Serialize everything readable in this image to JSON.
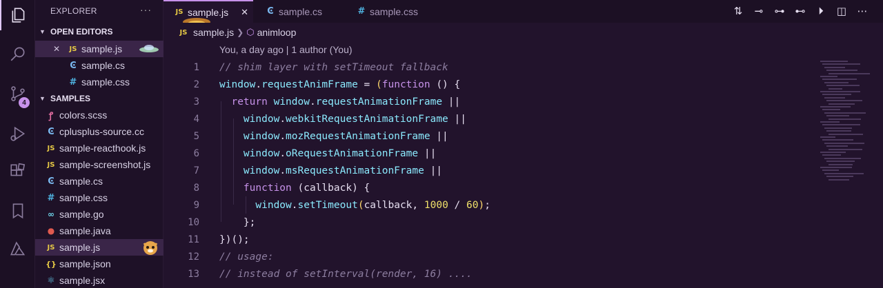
{
  "sidebar": {
    "title": "EXPLORER",
    "more": "···",
    "open_editors": {
      "label": "OPEN EDITORS",
      "items": [
        {
          "name": "sample.js",
          "icon": "JS"
        },
        {
          "name": "sample.cs",
          "icon": "C#"
        },
        {
          "name": "sample.css",
          "icon": "#"
        }
      ]
    },
    "samples": {
      "label": "SAMPLES",
      "items": [
        {
          "name": "colors.scss",
          "icon": "scss"
        },
        {
          "name": "cplusplus-source.cc",
          "icon": "c++"
        },
        {
          "name": "sample-reacthook.js",
          "icon": "JS"
        },
        {
          "name": "sample-screenshot.js",
          "icon": "JS"
        },
        {
          "name": "sample.cs",
          "icon": "C#"
        },
        {
          "name": "sample.css",
          "icon": "#"
        },
        {
          "name": "sample.go",
          "icon": "go"
        },
        {
          "name": "sample.java",
          "icon": "java"
        },
        {
          "name": "sample.js",
          "icon": "JS"
        },
        {
          "name": "sample.json",
          "icon": "{}"
        },
        {
          "name": "sample.jsx",
          "icon": "jsx"
        }
      ]
    }
  },
  "activity": {
    "scm_badge": "4"
  },
  "tabs": [
    {
      "label": "sample.js",
      "icon": "JS",
      "active": true
    },
    {
      "label": "sample.cs",
      "icon": "C#",
      "active": false
    },
    {
      "label": "sample.css",
      "icon": "#",
      "active": false
    }
  ],
  "breadcrumb": {
    "file": "sample.js",
    "symbol": "animloop"
  },
  "codelens": "You, a day ago | 1 author (You)",
  "code": {
    "line_numbers": [
      "1",
      "2",
      "3",
      "4",
      "5",
      "6",
      "7",
      "8",
      "9",
      "10",
      "11",
      "12",
      "13"
    ]
  },
  "colors": {
    "background": "#22132c",
    "accent": "#c792ea",
    "keyword": "#c792ea",
    "function": "#8be9fd",
    "comment": "#8d7ea0",
    "number": "#f0e16a"
  }
}
